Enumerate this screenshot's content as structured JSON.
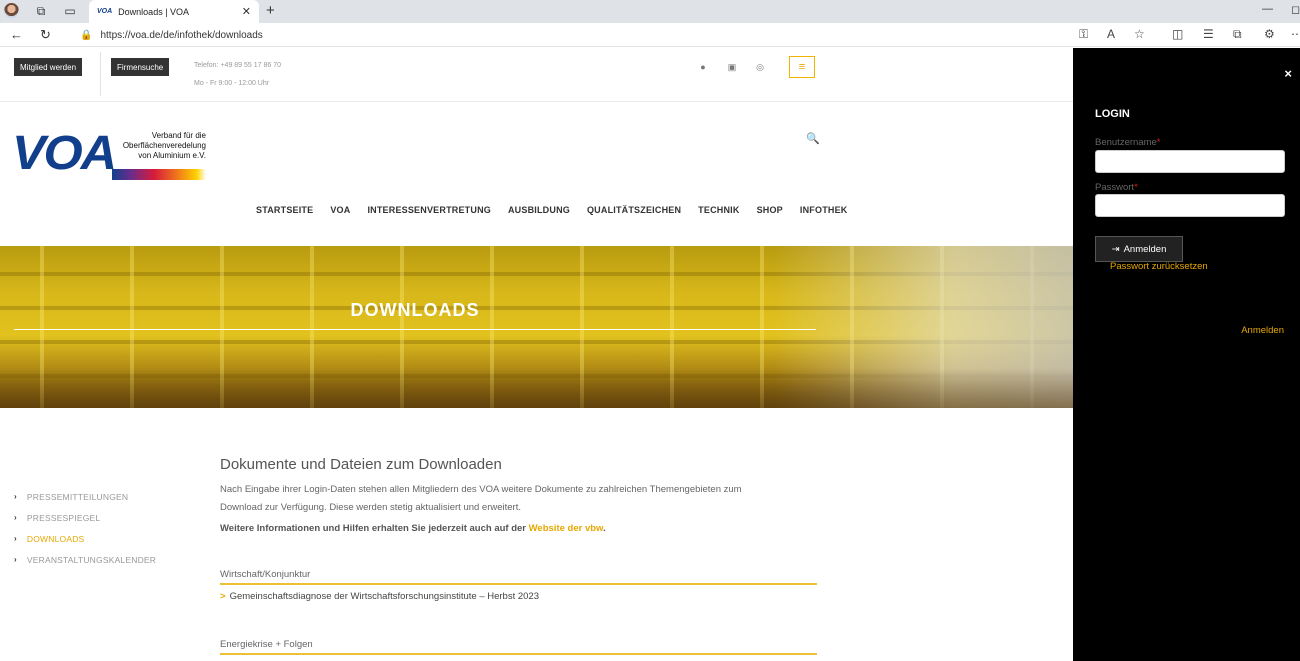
{
  "browser": {
    "tab_title": "Downloads | VOA",
    "tab_favicon": "VOA",
    "url": "https://voa.de/de/infothek/downloads"
  },
  "topbar": {
    "member_button": "Mitglied werden",
    "company_button": "Firmensuche",
    "phone": "Telefon: +49 89 55 17 86 70",
    "hours": "Mo - Fr 9:00 - 12:00 Uhr"
  },
  "logo": {
    "mark": "VOA",
    "tagline_1": "Verband für die",
    "tagline_2": "Oberflächenveredelung",
    "tagline_3": "von Aluminium e.V."
  },
  "nav": {
    "items": [
      "STARTSEITE",
      "VOA",
      "INTERESSENVERTRETUNG",
      "AUSBILDUNG",
      "QUALITÄTSZEICHEN",
      "TECHNIK",
      "SHOP",
      "INFOTHEK"
    ]
  },
  "hero": {
    "title": "DOWNLOADS"
  },
  "sidebar": {
    "items": [
      {
        "label": "PRESSEMITTEILUNGEN",
        "active": false
      },
      {
        "label": "PRESSESPIEGEL",
        "active": false
      },
      {
        "label": "DOWNLOADS",
        "active": true
      },
      {
        "label": "VERANSTALTUNGSKALENDER",
        "active": false
      }
    ]
  },
  "content": {
    "heading": "Dokumente und Dateien zum Downloaden",
    "intro_1": "Nach Eingabe ihrer Login-Daten stehen allen Mitgliedern des VOA weitere Dokumente zu zahlreichen Themengebieten zum",
    "intro_2": "Download zur Verfügung. Diese werden stetig aktualisiert und erweitert.",
    "info_text": "Weitere Informationen und Hilfen erhalten Sie jederzeit auch auf der ",
    "info_link": "Website der vbw",
    "info_end": ".",
    "categories": [
      {
        "title": "Wirtschaft/Konjunktur",
        "items": [
          "Gemeinschaftsdiagnose der Wirtschaftsforschungsinstitute – Herbst 2023"
        ]
      },
      {
        "title": "Energiekrise + Folgen",
        "items": []
      }
    ]
  },
  "login": {
    "title": "LOGIN",
    "username_label": "Benutzername",
    "password_label": "Passwort",
    "required_mark": "*",
    "submit": "Anmelden",
    "reset": "Passwort zurücksetzen",
    "login_link": "Anmelden",
    "close": "×"
  },
  "colors": {
    "accent": "#e6a800",
    "brand_blue": "#123f8c",
    "overlay": "#000000"
  }
}
